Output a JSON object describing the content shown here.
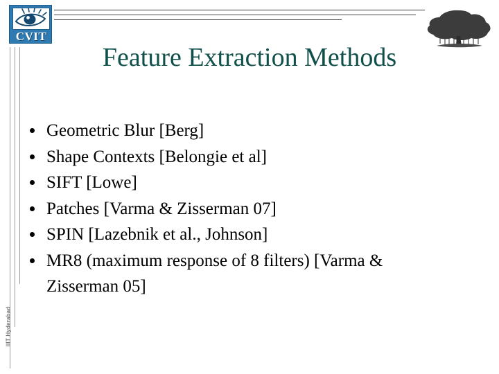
{
  "slide": {
    "title": "Feature Extraction Methods",
    "title_color": "#10504a",
    "background_color": "#ffffff",
    "body_text_color": "#000000"
  },
  "logo": {
    "name": "cvit-logo",
    "wordmark": "CVIT",
    "icon": "eye-icon",
    "background_color": "#2f7ab0",
    "plate_color": "#ffffff"
  },
  "emblem": {
    "name": "banyan-tree-emblem",
    "icon": "tree-icon",
    "color": "#3c3c3c"
  },
  "bullets": [
    {
      "text": "Geometric Blur [Berg]"
    },
    {
      "text": "Shape Contexts [Belongie et al]"
    },
    {
      "text": "SIFT [Lowe]"
    },
    {
      "text": "Patches [Varma & Zisserman 07]"
    },
    {
      "text": "SPIN [Lazebnik et al., Johnson]"
    },
    {
      "text": "MR8 (maximum response of 8 filters) [Varma & Zisserman 05]"
    }
  ],
  "footer": {
    "vertical_label": "IIIT Hyderabad",
    "color": "#7a7a7a"
  },
  "decoration": {
    "rule_color": "#4a4a4a",
    "vertical_rule_color": "#9a9a9a"
  }
}
